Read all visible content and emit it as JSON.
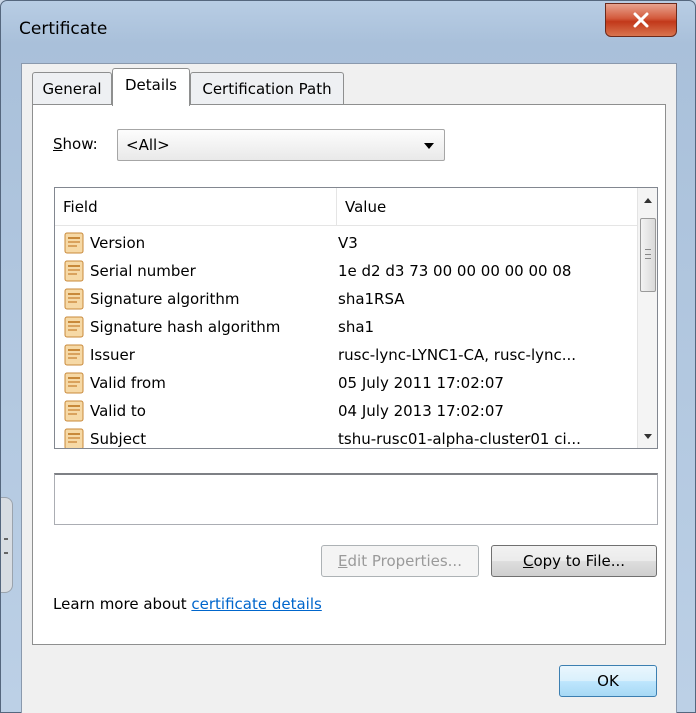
{
  "window": {
    "title": "Certificate"
  },
  "tabs": [
    {
      "label": "General"
    },
    {
      "label": "Details"
    },
    {
      "label": "Certification Path"
    }
  ],
  "show": {
    "label_accel": "S",
    "label_rest": "how:",
    "selected": "<All>"
  },
  "table": {
    "headers": {
      "field": "Field",
      "value": "Value"
    },
    "rows": [
      {
        "field": "Version",
        "value": "V3"
      },
      {
        "field": "Serial number",
        "value": "1e d2 d3 73 00 00 00 00 00 08"
      },
      {
        "field": "Signature algorithm",
        "value": "sha1RSA"
      },
      {
        "field": "Signature hash algorithm",
        "value": "sha1"
      },
      {
        "field": "Issuer",
        "value": "rusc-lync-LYNC1-CA, rusc-lync..."
      },
      {
        "field": "Valid from",
        "value": "05 July 2011 17:02:07"
      },
      {
        "field": "Valid to",
        "value": "04 July 2013 17:02:07"
      },
      {
        "field": "Subject",
        "value": "tshu-rusc01-alpha-cluster01 ci..."
      }
    ]
  },
  "buttons": {
    "edit_accel": "E",
    "edit_rest": "dit Properties...",
    "copy_accel": "C",
    "copy_rest": "opy to File...",
    "ok": "OK"
  },
  "learn": {
    "prefix": "Learn more about ",
    "link": "certificate details"
  },
  "colors": {
    "close_button": "#c2381a",
    "link": "#0066cc",
    "ok_button": "#bee6fd"
  }
}
